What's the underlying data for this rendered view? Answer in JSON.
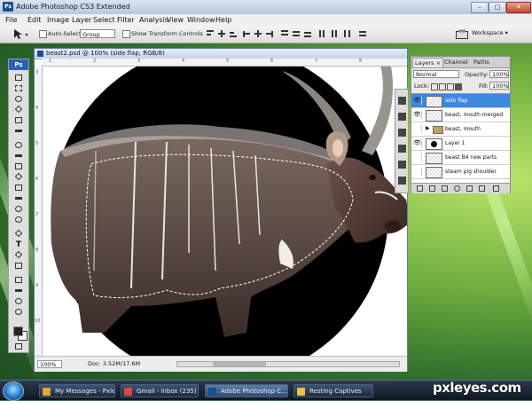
{
  "window": {
    "app_icon": "Ps",
    "title": "Adobe Photoshop CS3 Extended",
    "minimize_glyph": "–",
    "maximize_glyph": "□",
    "close_glyph": "✕"
  },
  "menu": [
    "File",
    "Edit",
    "Image",
    "Layer",
    "Select",
    "Filter",
    "Analysis",
    "View",
    "Window",
    "Help"
  ],
  "options_bar": {
    "auto_select_label": "Auto-Select:",
    "auto_select_value": "Group",
    "transform_label": "Show Transform Controls",
    "workspace_label": "Workspace ▾"
  },
  "tools": {
    "header": "Ps"
  },
  "document": {
    "title": "beast2.psd @ 100% (side flap, RGB/8)",
    "zoom": "100%",
    "doc_info": "Doc: 3.52M/17.6M",
    "ruler_top": [
      "1",
      "2",
      "3",
      "4",
      "5",
      "6",
      "7",
      "8"
    ],
    "ruler_left": [
      "3",
      "4",
      "5",
      "6",
      "7",
      "8",
      "9",
      "10"
    ]
  },
  "layers_panel": {
    "tabs": [
      "Layers ×",
      "Channel",
      "Paths"
    ],
    "blend_mode": "Normal",
    "opacity_label": "Opacity:",
    "opacity_value": "100%",
    "lock_label": "Lock:",
    "fill_label": "Fill:",
    "fill_value": "100%",
    "layers": [
      {
        "name": "side flap",
        "visible": true,
        "selected": true
      },
      {
        "name": "beast, mouth merged",
        "visible": true,
        "selected": false
      },
      {
        "name": "beast, mouth",
        "visible": false,
        "selected": false
      },
      {
        "name": "Layer 1",
        "visible": true,
        "selected": false
      },
      {
        "name": "beast B4 new parts",
        "visible": false,
        "selected": false
      },
      {
        "name": "steam pig shoulder",
        "visible": false,
        "selected": false
      }
    ]
  },
  "taskbar": {
    "items": [
      {
        "label": "My Messages - Pxle...",
        "active": false
      },
      {
        "label": "Gmail - Inbox (235) ...",
        "active": false
      },
      {
        "label": "Adobe Photoshop C...",
        "active": true
      },
      {
        "label": "Resting Captives",
        "active": false
      }
    ]
  },
  "watermark": "pxleyes.com",
  "colors": {
    "selected_layer": "#3c8ae0",
    "panel_bg": "#e9e9e9",
    "taskbar": "#1d2a3d"
  }
}
